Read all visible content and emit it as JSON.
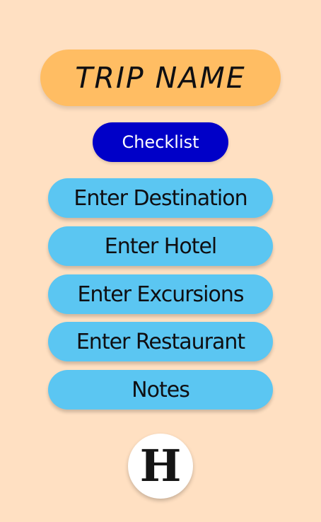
{
  "colors": {
    "background": "#ffe0c2",
    "trip_name_bg": "#ffbd63",
    "checklist_bg": "#0000c8",
    "checklist_text": "#ffffff",
    "nav_button_bg": "#5bc6f2"
  },
  "header": {
    "trip_name": "TRIP NAME"
  },
  "checklist_button": {
    "label": "Checklist"
  },
  "nav_buttons": [
    {
      "label": "Enter Destination"
    },
    {
      "label": "Enter Hotel"
    },
    {
      "label": "Enter Excursions"
    },
    {
      "label": "Enter Restaurant"
    },
    {
      "label": "Notes"
    }
  ],
  "home": {
    "logo_letter": "H",
    "icon": "home-logo-icon"
  }
}
